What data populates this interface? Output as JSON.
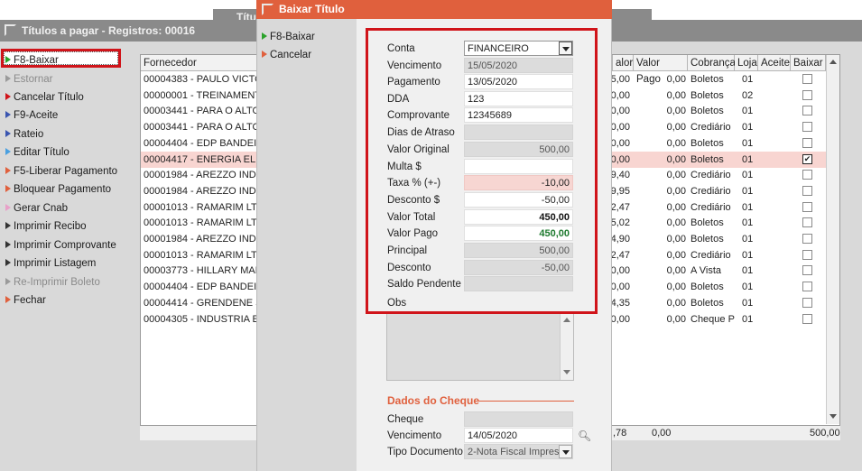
{
  "bg_window": {
    "title": "Títulos a pagar - Registros: 00016",
    "title2": "Títu"
  },
  "left_menu": [
    {
      "label": "F8-Baixar",
      "color": "#2aa22a",
      "disabled": false
    },
    {
      "label": "Estornar",
      "color": "#9a9a9a",
      "disabled": true
    },
    {
      "label": "Cancelar Título",
      "color": "#d0141a",
      "disabled": false
    },
    {
      "label": "F9-Aceite",
      "color": "#3a55b0",
      "disabled": false
    },
    {
      "label": "Rateio",
      "color": "#3a55b0",
      "disabled": false
    },
    {
      "label": "F6-Pagamento Parcial",
      "color": "#3a55b0",
      "disabled": false
    },
    {
      "label": "Editar Título",
      "color": "#4aa0e0",
      "disabled": false
    },
    {
      "label": "F5-Liberar Pagamento",
      "color": "#e0603d",
      "disabled": false
    },
    {
      "label": "Bloquear Pagamento",
      "color": "#e0603d",
      "disabled": false
    },
    {
      "label": "Gerar Cnab",
      "color": "#e8a0c8",
      "disabled": false
    },
    {
      "label": "Imprimir Recibo",
      "color": "#333333",
      "disabled": false
    },
    {
      "label": "Imprimir Comprovante",
      "color": "#333333",
      "disabled": false
    },
    {
      "label": "Imprimir Listagem",
      "color": "#333333",
      "disabled": false
    },
    {
      "label": "Re-Imprimir Boleto",
      "color": "#9a9a9a",
      "disabled": true
    },
    {
      "label": "Fechar",
      "color": "#e0603d",
      "disabled": false
    }
  ],
  "grid": {
    "headers": {
      "fornecedor": "Fornecedor",
      "valor": "alor",
      "valor_pago": "Valor Pago",
      "cobranca": "Cobrança",
      "loja": "Loja",
      "aceite": "Aceite",
      "baixar": "Baixar"
    },
    "rows": [
      {
        "fornecedor": "00004383 - PAULO VICTO",
        "valor": "5,00",
        "valor_pago": "0,00",
        "cobranca": "Boletos",
        "loja": "01",
        "baixar": false,
        "hl": false
      },
      {
        "fornecedor": "00000001 - TREINAMENTO",
        "valor": "0,00",
        "valor_pago": "0,00",
        "cobranca": "Boletos",
        "loja": "02",
        "baixar": false,
        "hl": false
      },
      {
        "fornecedor": "00003441 - PARA O ALTO",
        "valor": "0,00",
        "valor_pago": "0,00",
        "cobranca": "Boletos",
        "loja": "01",
        "baixar": false,
        "hl": false
      },
      {
        "fornecedor": "00003441 - PARA O ALTO",
        "valor": "0,00",
        "valor_pago": "0,00",
        "cobranca": "Crediário",
        "loja": "01",
        "baixar": false,
        "hl": false
      },
      {
        "fornecedor": "00004404 - EDP BANDEIRA",
        "valor": "0,00",
        "valor_pago": "0,00",
        "cobranca": "Boletos",
        "loja": "01",
        "baixar": false,
        "hl": false
      },
      {
        "fornecedor": "00004417 - ENERGIA ELET",
        "valor": "0,00",
        "valor_pago": "0,00",
        "cobranca": "Boletos",
        "loja": "01",
        "baixar": true,
        "hl": true
      },
      {
        "fornecedor": "00001984 - AREZZO INDU",
        "valor": "9,40",
        "valor_pago": "0,00",
        "cobranca": "Crediário",
        "loja": "01",
        "baixar": false,
        "hl": false
      },
      {
        "fornecedor": "00001984 - AREZZO INDU",
        "valor": "9,95",
        "valor_pago": "0,00",
        "cobranca": "Crediário",
        "loja": "01",
        "baixar": false,
        "hl": false
      },
      {
        "fornecedor": "00001013 - RAMARIM LTD",
        "valor": "2,47",
        "valor_pago": "0,00",
        "cobranca": "Crediário",
        "loja": "01",
        "baixar": false,
        "hl": false
      },
      {
        "fornecedor": "00001013 - RAMARIM LTD",
        "valor": "5,02",
        "valor_pago": "0,00",
        "cobranca": "Boletos",
        "loja": "01",
        "baixar": false,
        "hl": false
      },
      {
        "fornecedor": "00001984 - AREZZO INDU",
        "valor": "4,90",
        "valor_pago": "0,00",
        "cobranca": "Boletos",
        "loja": "01",
        "baixar": false,
        "hl": false
      },
      {
        "fornecedor": "00001013 - RAMARIM LTD",
        "valor": "2,47",
        "valor_pago": "0,00",
        "cobranca": "Crediário",
        "loja": "01",
        "baixar": false,
        "hl": false
      },
      {
        "fornecedor": "00003773 - HILLARY MAR",
        "valor": "0,00",
        "valor_pago": "0,00",
        "cobranca": "A Vista",
        "loja": "01",
        "baixar": false,
        "hl": false
      },
      {
        "fornecedor": "00004404 - EDP BANDEIRA",
        "valor": "0,00",
        "valor_pago": "0,00",
        "cobranca": "Boletos",
        "loja": "01",
        "baixar": false,
        "hl": false
      },
      {
        "fornecedor": "00004414 - GRENDENE S/A",
        "valor": "4,35",
        "valor_pago": "0,00",
        "cobranca": "Boletos",
        "loja": "01",
        "baixar": false,
        "hl": false
      },
      {
        "fornecedor": "00004305 - INDUSTRIA E C",
        "valor": "0,00",
        "valor_pago": "0,00",
        "cobranca": "Cheque P",
        "loja": "01",
        "baixar": false,
        "hl": false
      }
    ],
    "footer": {
      "valor": ",78",
      "valor_pago": "0,00",
      "total": "500,00"
    }
  },
  "modal": {
    "title": "Baixar Título",
    "menu": [
      {
        "label": "F8-Baixar",
        "color": "#2aa22a"
      },
      {
        "label": "Cancelar",
        "color": "#e0603d"
      }
    ],
    "fields": {
      "conta": {
        "label": "Conta",
        "value": "FINANCEIRO"
      },
      "vencimento": {
        "label": "Vencimento",
        "value": "15/05/2020"
      },
      "pagamento": {
        "label": "Pagamento",
        "value": "13/05/2020"
      },
      "dda": {
        "label": "DDA",
        "value": "123"
      },
      "comprovante": {
        "label": "Comprovante",
        "value": "12345689"
      },
      "dias_atraso": {
        "label": "Dias de Atraso",
        "value": ""
      },
      "valor_original": {
        "label": "Valor Original",
        "value": "500,00"
      },
      "multa": {
        "label": "Multa $",
        "value": ""
      },
      "taxa": {
        "label": "Taxa % (+-)",
        "value": "-10,00"
      },
      "desconto_pct": {
        "label": "Desconto $",
        "value": "-50,00"
      },
      "valor_total": {
        "label": "Valor Total",
        "value": "450,00"
      },
      "valor_pago": {
        "label": "Valor Pago",
        "value": "450,00"
      },
      "principal": {
        "label": "Principal",
        "value": "500,00"
      },
      "desconto": {
        "label": "Desconto",
        "value": "-50,00"
      },
      "saldo_pendente": {
        "label": "Saldo Pendente",
        "value": ""
      },
      "obs": {
        "label": "Obs",
        "value": ""
      }
    },
    "cheque": {
      "title": "Dados do Cheque",
      "cheque": {
        "label": "Cheque",
        "value": ""
      },
      "vencimento": {
        "label": "Vencimento",
        "value": "14/05/2020"
      },
      "tipo_documento": {
        "label": "Tipo Documento",
        "value": "2-Nota Fiscal Impres"
      }
    }
  }
}
